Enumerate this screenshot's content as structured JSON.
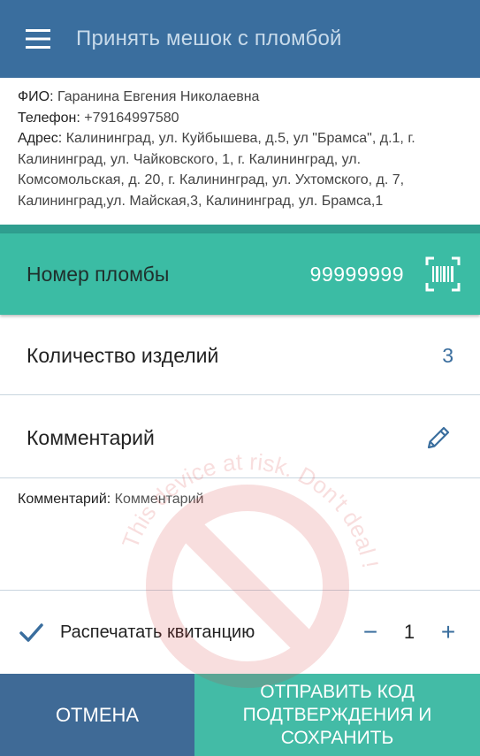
{
  "app": {
    "title": "Принять мешок с пломбой",
    "menu_icon": "hamburger-menu-icon"
  },
  "recipient": {
    "name_label": "ФИО:",
    "name_value": "Гаранина Евгения Николаевна",
    "phone_label": "Телефон:",
    "phone_value": "+79164997580",
    "address_label": "Адрес:",
    "address_value": "Калининград, ул. Куйбышева, д.5, ул \"Брамса\", д.1, г. Калининград, ул. Чайковского, 1, г. Калининград, ул. Комсомольская, д. 20, г. Калининград, ул. Ухтомского, д. 7, Калининград,ул. Майская,3, Калининград, ул. Брамса,1"
  },
  "seal": {
    "label": "Номер пломбы",
    "value": "99999999",
    "scan_icon": "barcode-scan-icon"
  },
  "quantity": {
    "label": "Количество изделий",
    "value": "3"
  },
  "comment": {
    "label": "Комментарий",
    "edit_icon": "pencil-icon",
    "text_label": "Комментарий:",
    "text_value": "Комментарий"
  },
  "print": {
    "label": "Распечатать квитанцию",
    "checked": true,
    "minus": "−",
    "count": "1",
    "plus": "+"
  },
  "actions": {
    "cancel_label": "ОТМЕНА",
    "submit_label": "ОТПРАВИТЬ КОД ПОДТВЕРЖДЕНИЯ И СОХРАНИТЬ"
  },
  "watermark": {
    "text": "This device at risk. Don't deal !",
    "color": "#d93a3a"
  },
  "colors": {
    "appbar": "#3a6e9e",
    "teal": "#3bbca4",
    "cancel": "#3f6a96",
    "submit": "#43bba6"
  }
}
